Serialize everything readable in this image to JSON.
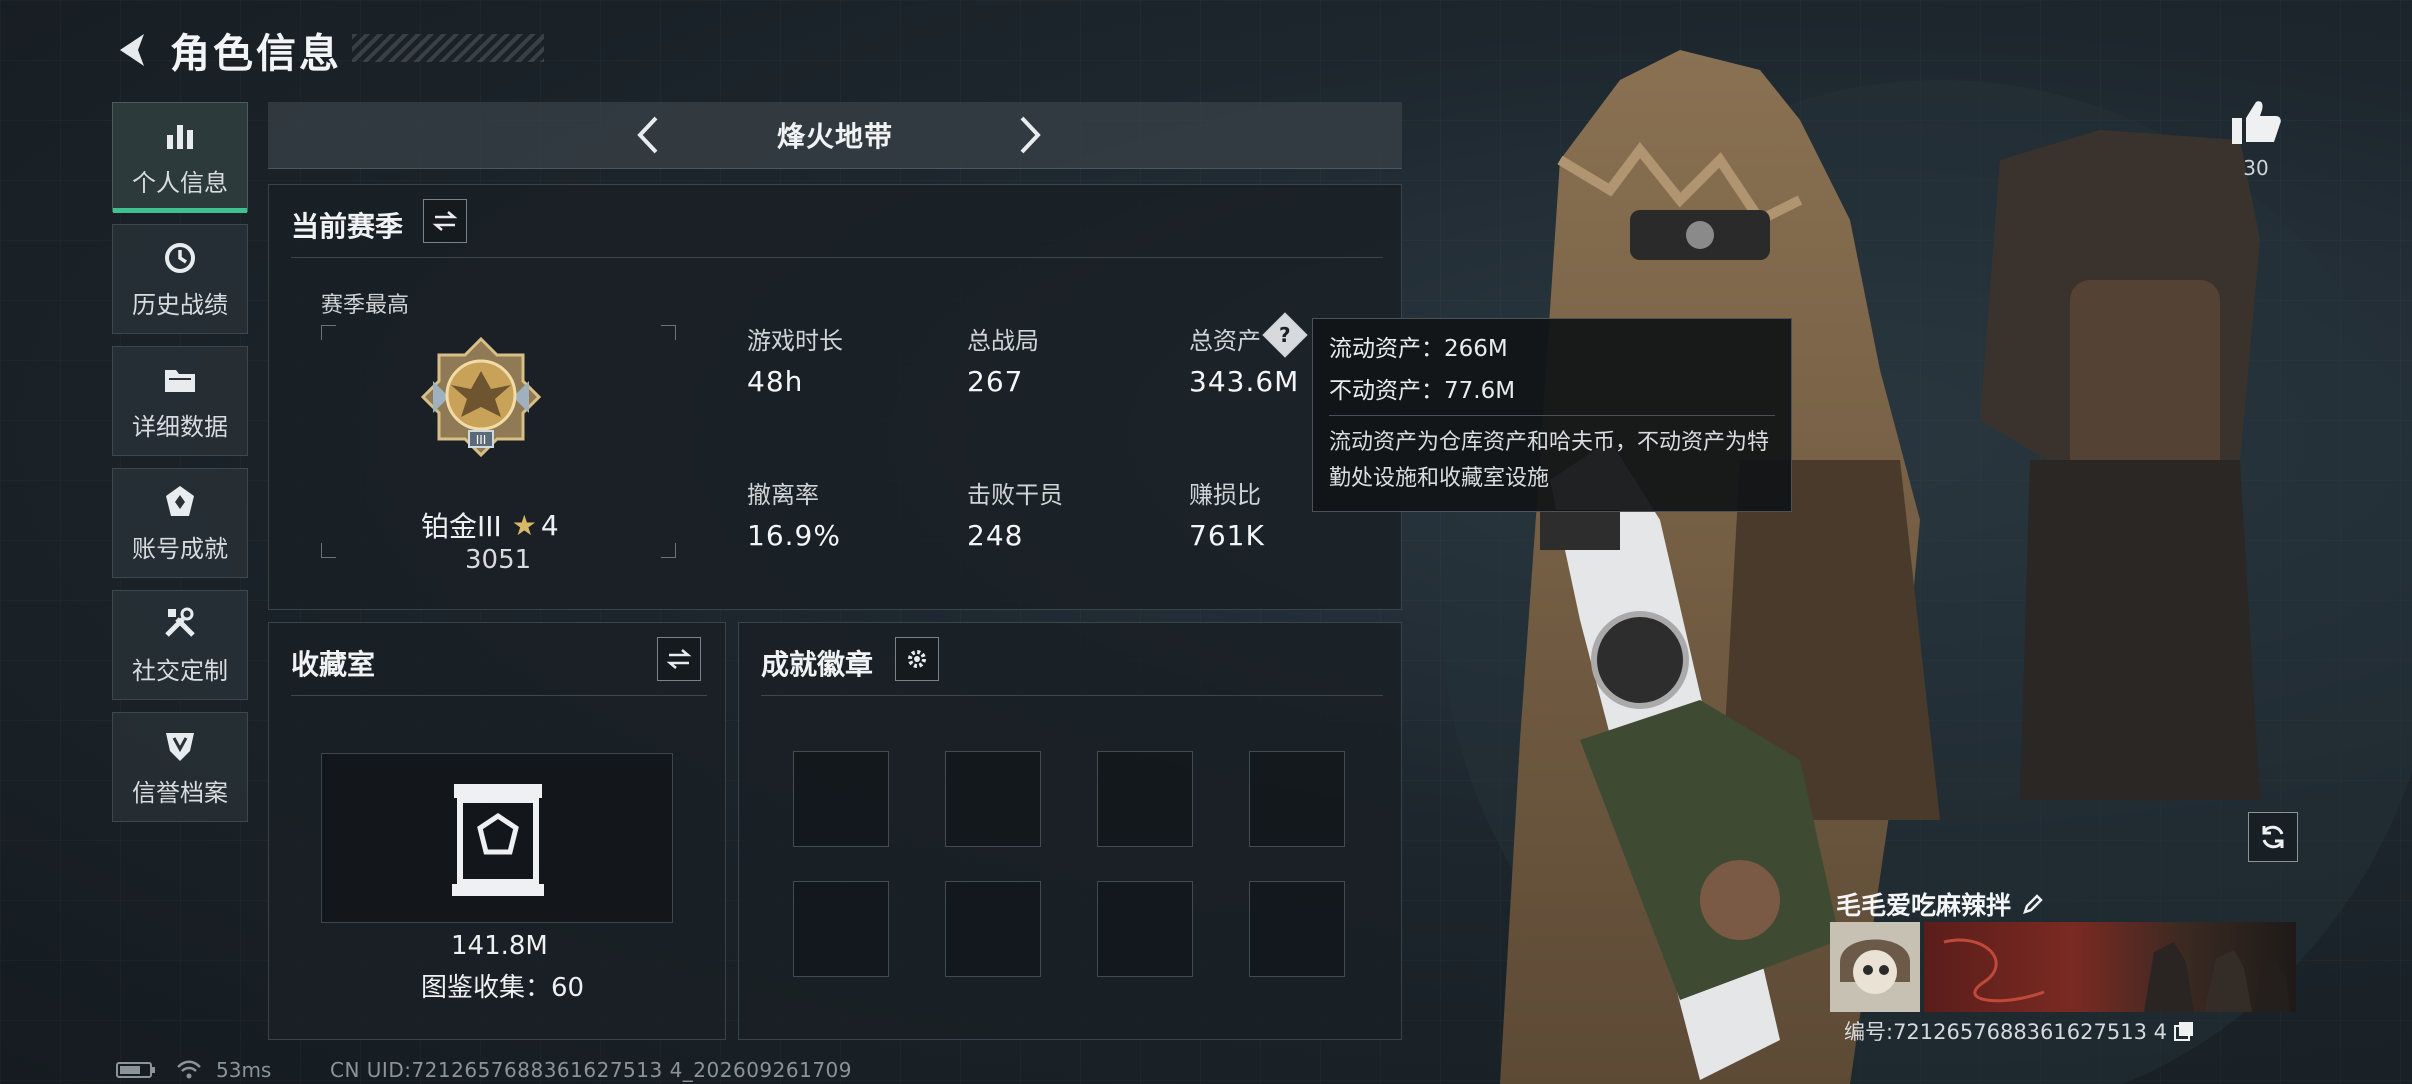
{
  "header": {
    "title": "角色信息"
  },
  "nav": {
    "items": [
      {
        "label": "个人信息",
        "icon": "bar-chart-icon"
      },
      {
        "label": "历史战绩",
        "icon": "clock-icon"
      },
      {
        "label": "详细数据",
        "icon": "folder-icon"
      },
      {
        "label": "账号成就",
        "icon": "achievement-icon"
      },
      {
        "label": "社交定制",
        "icon": "tools-icon"
      },
      {
        "label": "信誉档案",
        "icon": "shield-icon"
      }
    ]
  },
  "mode": {
    "label": "烽火地带"
  },
  "season": {
    "title": "当前赛季",
    "best_label": "赛季最高",
    "rank_name": "铂金III",
    "rank_stars": "4",
    "rank_score": "3051",
    "stats": [
      {
        "label": "游戏时长",
        "value": "48h"
      },
      {
        "label": "总战局",
        "value": "267"
      },
      {
        "label": "总资产",
        "value": "343.6M"
      },
      {
        "label": "撤离率",
        "value": "16.9%"
      },
      {
        "label": "击败干员",
        "value": "248"
      },
      {
        "label": "赚损比",
        "value": "761K"
      }
    ]
  },
  "tooltip": {
    "liquid": "流动资产：266M",
    "fixed": "不动资产：77.6M",
    "desc": "流动资产为仓库资产和哈夫币，不动资产为特勤处设施和收藏室设施"
  },
  "collection": {
    "title": "收藏室",
    "value": "141.8M",
    "catalog": "图鉴收集：60"
  },
  "badges": {
    "title": "成就徽章"
  },
  "profile": {
    "likes": "30",
    "name": "毛毛爱吃麻辣拌",
    "id": "编号:7212657688361627513 4"
  },
  "status": {
    "ping": "53ms",
    "uid": "CN UID:7212657688361627513 4_202609261709"
  },
  "colors": {
    "accent": "#3ec28f",
    "panel": "#1a2025",
    "rank_gold": "#c9a25a"
  }
}
